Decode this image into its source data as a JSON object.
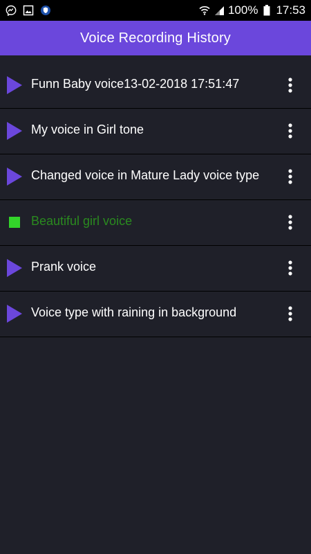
{
  "status_bar": {
    "left_icons": [
      "messenger-icon",
      "image-icon",
      "shield-app-icon"
    ],
    "battery_percent": "100%",
    "time": "17:53"
  },
  "app_bar": {
    "title": "Voice Recording History",
    "color": "#6b47dc"
  },
  "recordings": [
    {
      "title": "Funn Baby voice13-02-2018 17:51:47",
      "state": "play"
    },
    {
      "title": "My voice in Girl tone",
      "state": "play"
    },
    {
      "title": "Changed voice  in Mature Lady voice type",
      "state": "play"
    },
    {
      "title": "Beautiful girl voice",
      "state": "playing"
    },
    {
      "title": "Prank voice",
      "state": "play"
    },
    {
      "title": "Voice type  with raining in background",
      "state": "play"
    }
  ],
  "colors": {
    "background": "#1f2029",
    "play_icon": "#6b47dc",
    "stop_icon": "#33d42a",
    "active_text": "#2a8a1f"
  }
}
